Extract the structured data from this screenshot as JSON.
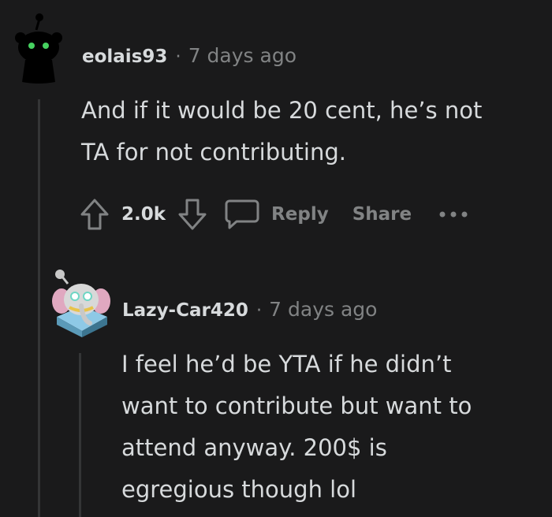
{
  "comment": {
    "username": "eolais93",
    "separator": "·",
    "timestamp": "7 days ago",
    "body_lines": [
      "And if it would be 20 cent, he’s not",
      "TA for not contributing."
    ],
    "upvote_icon": "upvote-arrow-icon",
    "vote_count": "2.0k",
    "downvote_icon": "downvote-arrow-icon",
    "reply_icon": "speech-bubble-icon",
    "reply_label": "Reply",
    "share_label": "Share",
    "more_icon": "ellipsis-icon"
  },
  "reply": {
    "username": "Lazy-Car420",
    "separator": "·",
    "timestamp": "7 days ago",
    "body_lines": [
      "I feel he’d be YTA if he didn’t",
      "want to contribute but want to",
      "attend anyway. 200$ is",
      "egregious though lol"
    ]
  },
  "colors": {
    "background": "#1a1a1b",
    "text": "#d7dadc",
    "muted": "#818384",
    "thread_line": "#343536",
    "avatar_accent": "#46d160"
  }
}
